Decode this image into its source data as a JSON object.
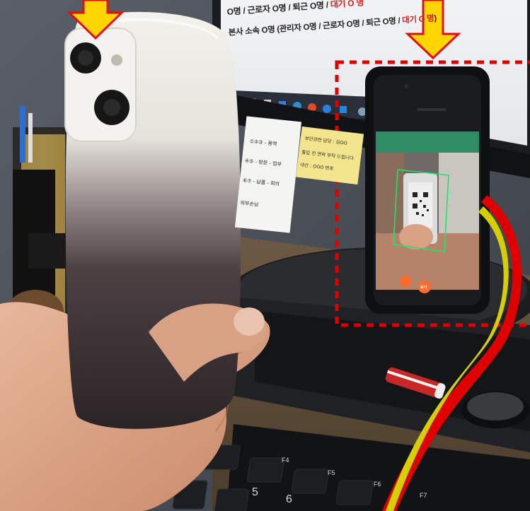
{
  "monitor_text": {
    "line1_prefix": "O명 / 근로자 O명 / 퇴근 O명 / ",
    "line1_highlight": "대기 O 명",
    "line2_prefix": "본사 소속 O명 (관리자 O명 / 근로자 O명 / 퇴근 O명 / ",
    "line2_highlight": "대기 O 명",
    "line2_suffix": ")"
  },
  "sticky_note_left": {
    "line1": "①②③ - 용역",
    "line2": "④⑤ - 방문 - 업무",
    "line3": "⑥⑦ - 납품 - 회의",
    "line4": "외부손님"
  },
  "sticky_note_yellow": {
    "line1": "보안관련 담당 : 김OO",
    "line2": "출입 전 연락 부탁 드립니다",
    "line3": "내선 : OOO 번호"
  },
  "phone_screen": {
    "button_label": "보기"
  },
  "keyboard": {
    "function_keys": [
      "F4",
      "F5",
      "F6",
      "F7"
    ],
    "number_keys": [
      "5",
      "6"
    ]
  },
  "annotation_colors": {
    "arrow_fill": "#ffd400",
    "arrow_stroke": "#e01010",
    "dashed_box": "#e00000",
    "curve_fill": "#c8c400",
    "curve_stroke": "#e00000"
  }
}
